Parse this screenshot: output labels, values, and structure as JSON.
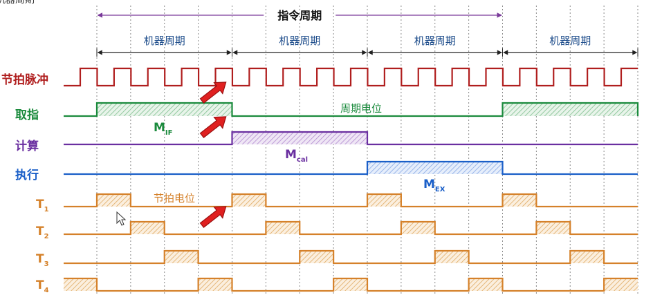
{
  "header": {
    "corner_text": "机器周期",
    "instruction_cycle_label": "指令周期",
    "machine_cycle_labels": [
      "机器周期",
      "机器周期",
      "机器周期",
      "机器周期"
    ]
  },
  "rows": [
    {
      "id": "clock",
      "label": "节拍脉冲",
      "color": "#b01e1e"
    },
    {
      "id": "fetch",
      "label": "取指",
      "color": "#1a8a3c"
    },
    {
      "id": "calc",
      "label": "计算",
      "color": "#6a2fa0"
    },
    {
      "id": "exec",
      "label": "执行",
      "color": "#1a5fc8"
    },
    {
      "id": "t1",
      "label": "T",
      "sub": "1",
      "color": "#d5812a"
    },
    {
      "id": "t2",
      "label": "T",
      "sub": "2",
      "color": "#d5812a"
    },
    {
      "id": "t3",
      "label": "T",
      "sub": "3",
      "color": "#d5812a"
    },
    {
      "id": "t4",
      "label": "T",
      "sub": "4",
      "color": "#d5812a"
    }
  ],
  "annotations": {
    "cycle_level": "周期电位",
    "beat_level": "节拍电位",
    "m_if": {
      "main": "M",
      "sub": "IF"
    },
    "m_cal": {
      "main": "M",
      "sub": "cal"
    },
    "m_ex": {
      "main": "M",
      "sub": "EX"
    }
  },
  "timing": {
    "machine_cycles": 4,
    "beats_per_cycle": 4,
    "fetch_high_cycles": [
      0,
      3
    ],
    "calc_high_cycles": [
      1
    ],
    "exec_high_cycles": [
      2
    ],
    "instruction_cycle_span": [
      0,
      3
    ]
  },
  "colors": {
    "clock": "#b01e1e",
    "fetch": "#1a8a3c",
    "calc": "#6a2fa0",
    "exec": "#1a5fc8",
    "beat": "#d5812a",
    "arrow": "#e02020",
    "grid": "#888888",
    "span": "#7a3a9a"
  }
}
